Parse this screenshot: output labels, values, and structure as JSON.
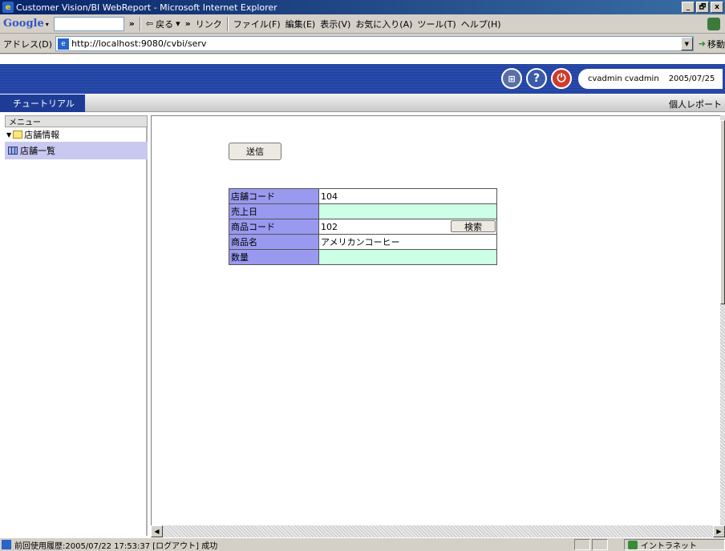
{
  "window": {
    "title": "Customer Vision/BI WebReport - Microsoft Internet Explorer",
    "buttons": [
      "_",
      "🗗",
      "x"
    ]
  },
  "toolbar": {
    "google_label": "Google",
    "back_label": "戻る",
    "links_label": "リンク",
    "menu_items": [
      "ファイル(F)",
      "編集(E)",
      "表示(V)",
      "お気に入り(A)",
      "ツール(T)",
      "ヘルプ(H)"
    ]
  },
  "address_bar": {
    "label": "アドレス(D)",
    "url": "http://localhost:9080/cvbi/serv",
    "go_label": "移動"
  },
  "header": {
    "user": "cvadmin cvadmin",
    "date": "2005/07/25"
  },
  "nav": {
    "tab_label": "チュートリアル",
    "report_link": "個人レポート"
  },
  "menu": {
    "title": "メニュー",
    "folder": "店舗情報",
    "item": "店舗一覧"
  },
  "form": {
    "send_label": "送信",
    "search_label": "検索",
    "rows": [
      {
        "label": "店舗コード",
        "value": ""
      },
      {
        "label": "売上日",
        "value": ""
      },
      {
        "label": "商品コード",
        "value": ""
      },
      {
        "label": "商品名",
        "value": "アメリカンコーヒー"
      },
      {
        "label": "数量",
        "value": ""
      }
    ],
    "store_code_value": "104",
    "product_code_value": "102"
  },
  "status": {
    "text": "前回使用履歴:2005/07/22 17:53:37 [ログアウト] 成功",
    "zone": "イントラネット"
  },
  "colors": {
    "header_blue": "#1e3c96",
    "label_bg": "#9999f0",
    "required_bg": "#ccffe6",
    "selected_menu": "#c8c8f0"
  }
}
